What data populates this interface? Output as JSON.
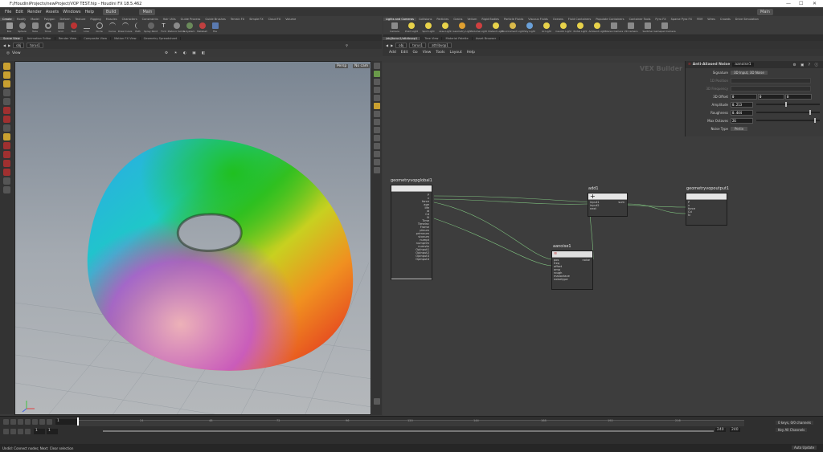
{
  "window": {
    "title": "F:/HoudiniProjects/newProject/VOP TEST.hip - Houdini FX 18.5.462"
  },
  "menubar": {
    "items": [
      "File",
      "Edit",
      "Render",
      "Assets",
      "Windows",
      "Help"
    ],
    "build_desktop": "Build",
    "main_desktop": "Main",
    "right_desktop": "Main"
  },
  "shelf_left": {
    "tabs": [
      "Create",
      "Modify",
      "Model",
      "Polygon",
      "Deform",
      "Texture",
      "Rigging",
      "Muscles",
      "Characters",
      "Constraints",
      "Hair Utils",
      "Guide Process",
      "Guide Brushes",
      "Terrain FX",
      "Simple FX",
      "Cloud FX",
      "Volume"
    ],
    "tools": [
      "Box",
      "Sphere",
      "Tube",
      "Torus",
      "Grid",
      "Null",
      "Line",
      "Circle",
      "Curve",
      "Draw Curve",
      "Path",
      "Spray Paint",
      "Font",
      "Platonic Solids",
      "L-System",
      "Metaball",
      "File"
    ]
  },
  "shelf_right": {
    "tabs": [
      "Lights and Cameras",
      "Collisions",
      "Particles",
      "Grains",
      "Vellum",
      "Rigid Bodies",
      "Particle Fluids",
      "Viscous Fluids",
      "Oceans",
      "Fluid Containers",
      "Populate Containers",
      "Container Tools",
      "Pyro FX",
      "Sparse Pyro FX",
      "FEM",
      "Wires",
      "Crowds",
      "Drive Simulation"
    ],
    "tools": [
      "Camera",
      "Point Light",
      "Spot Light",
      "Area Light",
      "Geometry Light",
      "Volume Light",
      "Distant Light",
      "Environment Light",
      "Sky Light",
      "GI Light",
      "Caustic Light",
      "Portal Light",
      "Ambient Light",
      "Stereo Camera",
      "VR Camera",
      "Switcher",
      "Gamepad Camera"
    ]
  },
  "left_panes": {
    "tabs": [
      "Scene View",
      "Animation Editor",
      "Render View",
      "Composite View",
      "Motion FX View",
      "Geometry Spreadsheet"
    ],
    "path_root": "obj",
    "path_node": "torus1",
    "view_label": "View",
    "persp_label": "Persp",
    "cam_label": "No cam"
  },
  "right_panes": {
    "tabs": [
      "/obj/torus1/attribvop1",
      "Tree View",
      "Material Palette",
      "Asset Browser"
    ],
    "path_root": "obj",
    "path_node1": "torus1",
    "path_node2": "attribvop1",
    "menu": [
      "Add",
      "Edit",
      "Go",
      "View",
      "Tools",
      "Layout",
      "Help"
    ],
    "context_label": "VEX Builder"
  },
  "params": {
    "node_type": "Anti-Aliased Noise",
    "node_name": "aanoise1",
    "rows": [
      {
        "label": "Signature",
        "value": "3D Input, 3D Noise"
      },
      {
        "label": "1D Position",
        "value": ""
      },
      {
        "label": "3D Frequency",
        "value": ""
      },
      {
        "label": "3D Offset",
        "value": "0"
      },
      {
        "label": "Amplitude",
        "value": "0.213"
      },
      {
        "label": "Roughness",
        "value": "0.444"
      },
      {
        "label": "Max Octaves",
        "value": "26"
      },
      {
        "label": "Noise Type",
        "value": "Perlin"
      }
    ],
    "offset_values": [
      "0",
      "0",
      "0"
    ],
    "amplitude_fraction": 0.45,
    "roughness_fraction": 0.83,
    "octaves_fraction": 0.91
  },
  "nodes": {
    "global": {
      "name": "geometryvopglobal1",
      "ports": [
        "P",
        "v",
        "force",
        "age",
        "life",
        "id",
        "Cd",
        "N",
        "Time",
        "TimeInc",
        "Frame",
        "ptnum",
        "primnum",
        "vtxnum",
        "numpt",
        "numprim",
        "numvtx",
        "OpInput1",
        "OpInput2",
        "OpInput3",
        "OpInput4"
      ]
    },
    "add": {
      "name": "add1",
      "ports_in": [
        "input1",
        "input2",
        "next"
      ],
      "port_out": "sum"
    },
    "aanoise": {
      "name": "aanoise1",
      "ports_in": [
        "pos",
        "freq",
        "offset",
        "amp",
        "rough",
        "maxoctave",
        "noisetype"
      ],
      "port_out": "noise"
    },
    "output": {
      "name": "geometryvopoutput1",
      "ports_in": [
        "P",
        "v",
        "force",
        "Cd",
        "N"
      ]
    }
  },
  "timeline": {
    "current_frame": "1",
    "start_frame": "1",
    "end_frame": "1",
    "range_end": "240",
    "range_end2": "240",
    "ticks": [
      "24",
      "48",
      "72",
      "96",
      "120",
      "144",
      "168",
      "192",
      "216"
    ],
    "keys_label": "0 keys, 0/0 channels",
    "key_all_label": "Key All Channels",
    "auto_update": "Auto Update"
  },
  "status": {
    "text": "Undid: Connect nodes; Next: Clear selection"
  }
}
